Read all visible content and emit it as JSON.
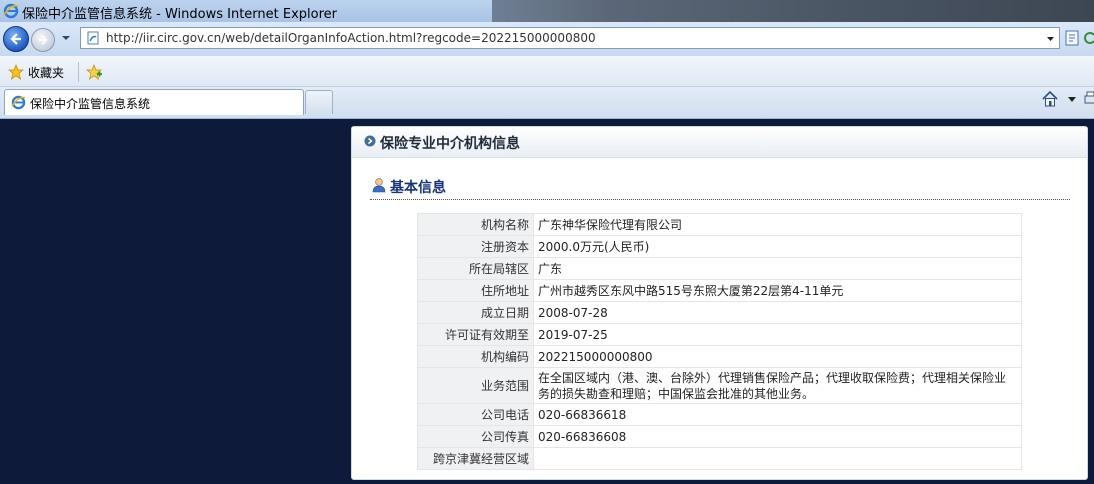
{
  "window": {
    "title": "保险中介监管信息系统 - Windows Internet Explorer"
  },
  "address_bar": {
    "url": "http://iir.circ.gov.cn/web/detailOrganInfoAction.html?regcode=202215000000800"
  },
  "favorites_bar": {
    "favorites_label": "收藏夹"
  },
  "tabs": [
    {
      "title": "保险中介监管信息系统"
    }
  ],
  "panel": {
    "title": "保险专业中介机构信息"
  },
  "section": {
    "title": "基本信息"
  },
  "info_rows": [
    {
      "label": "机构名称",
      "value": "广东神华保险代理有限公司"
    },
    {
      "label": "注册资本",
      "value": "2000.0万元(人民币)"
    },
    {
      "label": "所在局辖区",
      "value": "广东"
    },
    {
      "label": "住所地址",
      "value": "广州市越秀区东风中路515号东照大厦第22层第4-11单元"
    },
    {
      "label": "成立日期",
      "value": "2008-07-28"
    },
    {
      "label": "许可证有效期至",
      "value": "2019-07-25"
    },
    {
      "label": "机构编码",
      "value": "202215000000800"
    },
    {
      "label": "业务范围",
      "value": "在全国区域内（港、澳、台除外）代理销售保险产品；代理收取保险费；代理相关保险业务的损失勘查和理赔；中国保监会批准的其他业务。"
    },
    {
      "label": "公司电话",
      "value": "020-66836618"
    },
    {
      "label": "公司传真",
      "value": "020-66836608"
    },
    {
      "label": "跨京津冀经营区域",
      "value": ""
    }
  ],
  "colors": {
    "page_background": "#0d1a3a",
    "section_title": "#17337a",
    "label_cell_bg": "#f0f1f3"
  }
}
